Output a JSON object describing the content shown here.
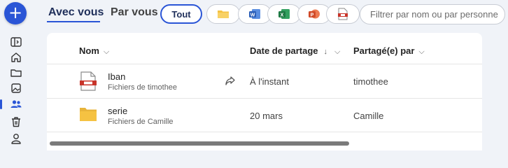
{
  "actions": {
    "new_button_label": "+"
  },
  "tabs": {
    "mine": "Avec vous",
    "shared": "Par vous"
  },
  "filters": {
    "all_label": "Tout",
    "types": [
      "folder-icon",
      "word-icon",
      "excel-icon",
      "powerpoint-icon",
      "pdf-icon"
    ]
  },
  "search": {
    "placeholder": "Filtrer par nom ou par personne"
  },
  "rail": {
    "icons": [
      "collapse-panel-icon",
      "home-icon",
      "folder-icon",
      "photos-icon",
      "shared-people-icon",
      "recycle-bin-icon",
      "account-icon"
    ],
    "active": "shared-people-icon"
  },
  "table": {
    "columns": {
      "name": "Nom",
      "date": "Date de partage",
      "shared_by": "Partagé(e) par"
    },
    "rows": [
      {
        "name": "Iban",
        "subtitle": "Fichiers de timothee",
        "date": "À l'instant",
        "shared_by": "timothee",
        "type": "pdf"
      },
      {
        "name": "serie",
        "subtitle": "Fichiers de Camille",
        "date": "20 mars",
        "shared_by": "Camille",
        "type": "folder"
      }
    ]
  },
  "colors": {
    "accent": "#2a55d6",
    "folder": "#f5c242",
    "word": "#2b5fb8",
    "excel": "#1f7a45",
    "powerpoint": "#d14b2a",
    "pdf": "#c8352b"
  }
}
